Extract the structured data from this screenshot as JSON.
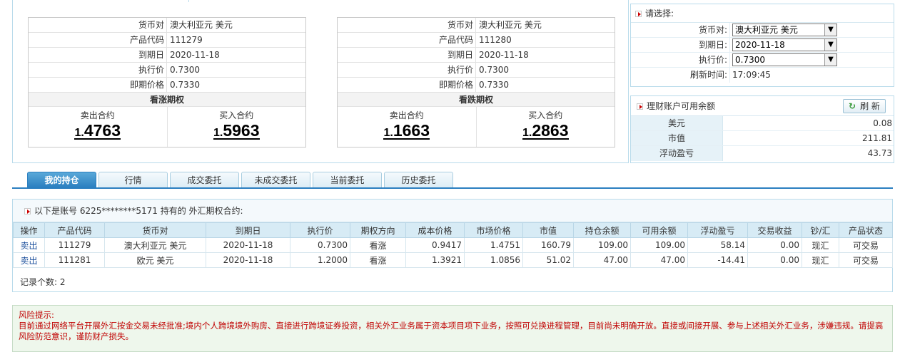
{
  "call_option": {
    "rows": [
      {
        "label": "货币对",
        "value": "澳大利亚元 美元"
      },
      {
        "label": "产品代码",
        "value": "111279"
      },
      {
        "label": "到期日",
        "value": "2020-11-18"
      },
      {
        "label": "执行价",
        "value": "0.7300"
      },
      {
        "label": "即期价格",
        "value": "0.7330"
      }
    ],
    "type_label": "看涨期权",
    "sell": {
      "label": "卖出合约",
      "prefix": "1.",
      "main": "4763"
    },
    "buy": {
      "label": "买入合约",
      "prefix": "1.",
      "main": "5963"
    }
  },
  "put_option": {
    "rows": [
      {
        "label": "货币对",
        "value": "澳大利亚元 美元"
      },
      {
        "label": "产品代码",
        "value": "111280"
      },
      {
        "label": "到期日",
        "value": "2020-11-18"
      },
      {
        "label": "执行价",
        "value": "0.7300"
      },
      {
        "label": "即期价格",
        "value": "0.7330"
      }
    ],
    "type_label": "看跌期权",
    "sell": {
      "label": "卖出合约",
      "prefix": "1.",
      "main": "1663"
    },
    "buy": {
      "label": "买入合约",
      "prefix": "1.",
      "main": "2863"
    }
  },
  "selector": {
    "title": "请选择:",
    "pair_label": "货币对:",
    "pair_value": "澳大利亚元 美元",
    "expiry_label": "到期日:",
    "expiry_value": "2020-11-18",
    "strike_label": "执行价:",
    "strike_value": "0.7300",
    "refresh_time_label": "刷新时间:",
    "refresh_time_value": "17:09:45"
  },
  "balance": {
    "title": "理财账户可用余额",
    "refresh_label": "刷 新",
    "rows": [
      {
        "label": "美元",
        "value": "0.08"
      },
      {
        "label": "市值",
        "value": "211.81"
      },
      {
        "label": "浮动盈亏",
        "value": "43.73"
      }
    ]
  },
  "tabs": [
    "我的持仓",
    "行情",
    "成交委托",
    "未成交委托",
    "当前委托",
    "历史委托"
  ],
  "holdings": {
    "header_text": "以下是账号 6225********5171 持有的 外汇期权合约:",
    "columns": [
      "操作",
      "产品代码",
      "货币对",
      "到期日",
      "执行价",
      "期权方向",
      "成本价格",
      "市场价格",
      "市值",
      "持仓余额",
      "可用余额",
      "浮动盈亏",
      "交易收益",
      "钞/汇",
      "产品状态"
    ],
    "rows": [
      [
        "卖出",
        "111279",
        "澳大利亚元 美元",
        "2020-11-18",
        "0.7300",
        "看涨",
        "0.9417",
        "1.4751",
        "160.79",
        "109.00",
        "109.00",
        "58.14",
        "0.00",
        "现汇",
        "可交易"
      ],
      [
        "卖出",
        "111281",
        "欧元 美元",
        "2020-11-18",
        "1.2000",
        "看涨",
        "1.3921",
        "1.0856",
        "51.02",
        "47.00",
        "47.00",
        "-14.41",
        "0.00",
        "现汇",
        "可交易"
      ]
    ],
    "record_count": "记录个数:  2"
  },
  "risk": {
    "title": "风险提示:",
    "text": "目前通过网络平台开展外汇按金交易未经批准;境内个人跨境境外购房、直接进行跨境证券投资，相关外汇业务属于资本项目项下业务，按照可兑换进程管理，目前尚未明确开放。直接或间接开展、参与上述相关外汇业务，涉嫌违规。请提高风险防范意识，谨防财产损失。"
  }
}
